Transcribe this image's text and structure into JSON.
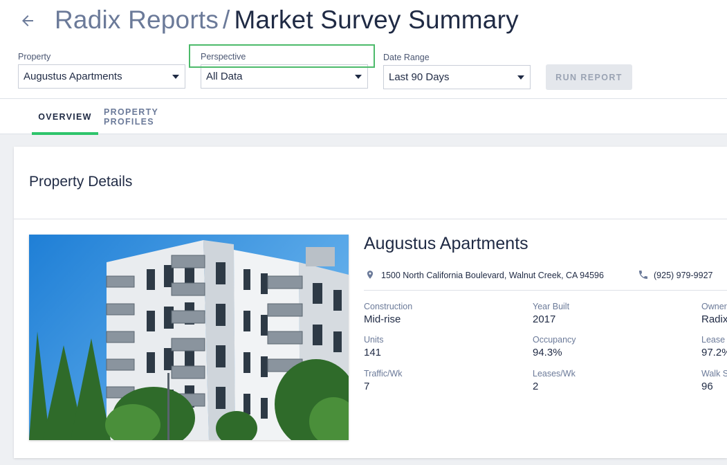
{
  "header": {
    "crumb": "Radix Reports",
    "separator": "/",
    "title": "Market Survey Summary"
  },
  "filters": {
    "property": {
      "label": "Property",
      "value": "Augustus Apartments"
    },
    "perspective": {
      "label": "Perspective",
      "value": "All Data"
    },
    "date_range": {
      "label": "Date Range",
      "value": "Last 90 Days"
    },
    "run_label": "RUN REPORT"
  },
  "tabs": [
    {
      "label": "OVERVIEW",
      "active": true
    },
    {
      "label": "PROPERTY PROFILES",
      "active": false
    }
  ],
  "card": {
    "title": "Property Details",
    "property_name": "Augustus Apartments",
    "address": "1500 North California Boulevard, Walnut Creek, CA 94596",
    "phone": "(925) 979-9927",
    "stats": [
      {
        "label": "Construction",
        "value": "Mid-rise"
      },
      {
        "label": "Year Built",
        "value": "2017"
      },
      {
        "label": "Owner",
        "value": "Radix"
      },
      {
        "label": "Units",
        "value": "141"
      },
      {
        "label": "Occupancy",
        "value": "94.3%"
      },
      {
        "label": "Lease",
        "value": "97.2%"
      },
      {
        "label": "Traffic/Wk",
        "value": "7"
      },
      {
        "label": "Leases/Wk",
        "value": "2"
      },
      {
        "label": "Walk S",
        "value": "96"
      }
    ]
  },
  "colors": {
    "accent_green": "#2ec46b",
    "focus_green": "#4cba6a",
    "title_dark": "#1f2a44",
    "muted": "#6b7a99"
  }
}
